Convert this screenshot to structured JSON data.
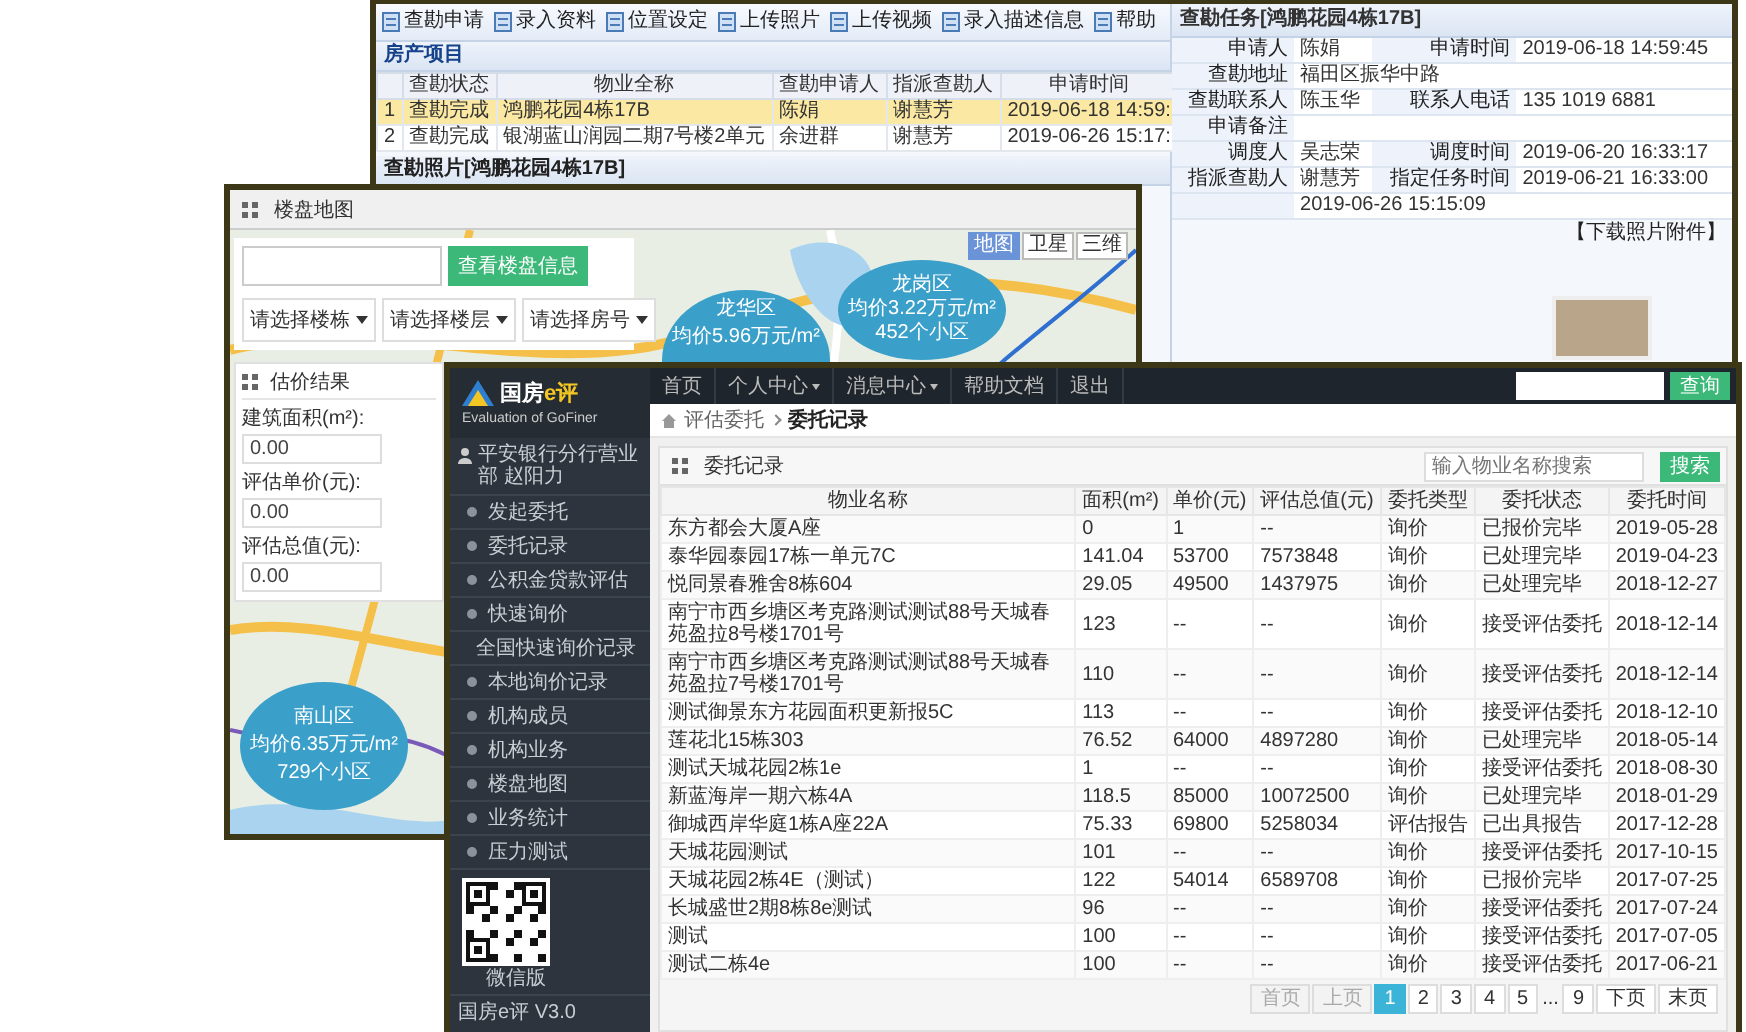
{
  "back_window": {
    "toolbar": [
      {
        "label": "查勘申请"
      },
      {
        "label": "录入资料"
      },
      {
        "label": "位置设定"
      },
      {
        "label": "上传照片"
      },
      {
        "label": "上传视频"
      },
      {
        "label": "录入描述信息"
      },
      {
        "label": "帮助"
      }
    ],
    "project_section": {
      "title": "房产项目",
      "grid": {
        "columns": [
          "查勘状态",
          "物业全称",
          "查勘申请人",
          "指派查勘人",
          "申请时间"
        ],
        "rows": [
          {
            "index": "1",
            "cells": [
              "查勘完成",
              "鸿鹏花园4栋17B",
              "陈娟",
              "谢慧芳",
              "2019-06-18 14:59:"
            ],
            "selected": true
          },
          {
            "index": "2",
            "cells": [
              "查勘完成",
              "银湖蓝山润园二期7号楼2单元",
              "余进群",
              "谢慧芳",
              "2019-06-26 15:17:"
            ],
            "selected": false
          }
        ]
      }
    },
    "photo_section": {
      "title": "查勘照片[鸿鹏花园4栋17B]"
    },
    "task_panel": {
      "title": "查勘任务[鸿鹏花园4栋17B]",
      "rows": [
        {
          "fields": [
            {
              "label": "申请人",
              "value": "陈娟"
            },
            {
              "label": "申请时间",
              "value": "2019-06-18 14:59:45"
            }
          ]
        },
        {
          "fields": [
            {
              "label": "查勘地址",
              "value": "福田区振华中路"
            }
          ]
        },
        {
          "fields": [
            {
              "label": "查勘联系人",
              "value": "陈玉华"
            },
            {
              "label": "联系人电话",
              "value": "135 1019 6881"
            }
          ]
        },
        {
          "fields": [
            {
              "label": "申请备注"
            }
          ]
        },
        {
          "fields": [
            {
              "label": "调度人",
              "value": "吴志荣"
            },
            {
              "label": "调度时间",
              "value": "2019-06-20 16:33:17"
            }
          ]
        },
        {
          "fields": [
            {
              "label": "指派查勘人",
              "value": "谢慧芳"
            },
            {
              "label": "指定任务时间",
              "value": "2019-06-21 16:33:00"
            }
          ]
        },
        {
          "fields": [
            {
              "value": "2019-06-26 15:15:09"
            }
          ]
        }
      ],
      "download_link": "【下载照片附件】"
    }
  },
  "map_window": {
    "title": "楼盘地图",
    "search_button": "查看楼盘信息",
    "selects": [
      "请选择楼栋",
      "请选择楼层",
      "请选择房号"
    ],
    "result_panel": {
      "title": "估价结果",
      "fields": [
        {
          "label": "建筑面积(m²):",
          "value": "0.00"
        },
        {
          "label": "评估单价(元):",
          "value": "0.00"
        },
        {
          "label": "评估总值(元):",
          "value": "0.00"
        }
      ]
    },
    "map_types": [
      {
        "label": "地图",
        "selected": true
      },
      {
        "label": "卫星",
        "selected": false
      },
      {
        "label": "三维",
        "selected": false
      }
    ],
    "clusters": [
      {
        "name": "龙华区",
        "price": "均价5.96万元/m²"
      },
      {
        "name": "龙岗区",
        "price": "均价3.22万元/m²",
        "count": "452个小区"
      },
      {
        "name": "南山区",
        "price": "均价6.35万元/m²",
        "count": "729个小区"
      }
    ]
  },
  "front_window": {
    "brand": {
      "name": "国房",
      "suffix": "e评",
      "tagline": "Evaluation of GoFiner"
    },
    "nav": [
      {
        "label": "首页",
        "dropdown": false
      },
      {
        "label": "个人中心",
        "dropdown": true
      },
      {
        "label": "消息中心",
        "dropdown": true
      },
      {
        "label": "帮助文档",
        "dropdown": false
      },
      {
        "label": "退出",
        "dropdown": false
      }
    ],
    "nav_search_button": "查询",
    "user": "平安银行分行营业部 赵阳力",
    "sidebar": [
      {
        "label": "发起委托"
      },
      {
        "label": "委托记录"
      },
      {
        "label": "公积金贷款评估"
      },
      {
        "label": "快速询价"
      },
      {
        "label": "全国快速询价记录"
      },
      {
        "label": "本地询价记录"
      },
      {
        "label": "机构成员"
      },
      {
        "label": "机构业务"
      },
      {
        "label": "楼盘地图"
      },
      {
        "label": "业务统计"
      },
      {
        "label": "压力测试"
      }
    ],
    "qr_caption": "微信版",
    "version": "国房e评 V3.0",
    "breadcrumb": [
      "评估委托",
      "委托记录"
    ],
    "panel_title": "委托记录",
    "search": {
      "placeholder": "输入物业名称搜索",
      "button": "搜索"
    },
    "table": {
      "columns": [
        "物业名称",
        "面积(m²)",
        "单价(元)",
        "评估总值(元)",
        "委托类型",
        "委托状态",
        "委托时间"
      ],
      "rows": [
        [
          "东方都会大厦A座",
          "0",
          "1",
          "--",
          "询价",
          "已报价完毕",
          "2019-05-28"
        ],
        [
          "泰华园泰园17栋一单元7C",
          "141.04",
          "53700",
          "7573848",
          "询价",
          "已处理完毕",
          "2019-04-23"
        ],
        [
          "悦同景春雅舍8栋604",
          "29.05",
          "49500",
          "1437975",
          "询价",
          "已处理完毕",
          "2018-12-27"
        ],
        [
          "南宁市西乡塘区考克路测试测试88号天城春苑盈拉8号楼1701号",
          "123",
          "--",
          "--",
          "询价",
          "接受评估委托",
          "2018-12-14"
        ],
        [
          "南宁市西乡塘区考克路测试测试88号天城春苑盈拉7号楼1701号",
          "110",
          "--",
          "--",
          "询价",
          "接受评估委托",
          "2018-12-14"
        ],
        [
          "测试御景东方花园面积更新报5C",
          "113",
          "--",
          "--",
          "询价",
          "接受评估委托",
          "2018-12-10"
        ],
        [
          "莲花北15栋303",
          "76.52",
          "64000",
          "4897280",
          "询价",
          "已处理完毕",
          "2018-05-14"
        ],
        [
          "测试天城花园2栋1e",
          "1",
          "--",
          "--",
          "询价",
          "接受评估委托",
          "2018-08-30"
        ],
        [
          "新蓝海岸一期六栋4A",
          "118.5",
          "85000",
          "10072500",
          "询价",
          "已处理完毕",
          "2018-01-29"
        ],
        [
          "御城西岸华庭1栋A座22A",
          "75.33",
          "69800",
          "5258034",
          "评估报告",
          "已出具报告",
          "2017-12-28"
        ],
        [
          "天城花园测试",
          "101",
          "--",
          "--",
          "询价",
          "接受评估委托",
          "2017-10-15"
        ],
        [
          "天城花园2栋4E（测试）",
          "122",
          "54014",
          "6589708",
          "询价",
          "已报价完毕",
          "2017-07-25"
        ],
        [
          "长城盛世2期8栋8e测试",
          "96",
          "--",
          "--",
          "询价",
          "接受评估委托",
          "2017-07-24"
        ],
        [
          "测试",
          "100",
          "--",
          "--",
          "询价",
          "接受评估委托",
          "2017-07-05"
        ],
        [
          "测试二栋4e",
          "100",
          "--",
          "--",
          "询价",
          "接受评估委托",
          "2017-06-21"
        ]
      ]
    },
    "pagination": [
      {
        "label": "首页",
        "kind": "nav",
        "disabled": true,
        "selected": false
      },
      {
        "label": "上页",
        "kind": "nav",
        "disabled": true,
        "selected": false
      },
      {
        "label": "1",
        "kind": "page",
        "disabled": false,
        "selected": true
      },
      {
        "label": "2",
        "kind": "page",
        "disabled": false,
        "selected": false
      },
      {
        "label": "3",
        "kind": "page",
        "disabled": false,
        "selected": false
      },
      {
        "label": "4",
        "kind": "page",
        "disabled": false,
        "selected": false
      },
      {
        "label": "5",
        "kind": "page",
        "disabled": false,
        "selected": false
      },
      {
        "label": "...",
        "kind": "gap",
        "disabled": false,
        "selected": false
      },
      {
        "label": "9",
        "kind": "page",
        "disabled": false,
        "selected": false
      },
      {
        "label": "下页",
        "kind": "nav",
        "disabled": false,
        "selected": false
      },
      {
        "label": "末页",
        "kind": "nav",
        "disabled": false,
        "selected": false
      }
    ]
  }
}
